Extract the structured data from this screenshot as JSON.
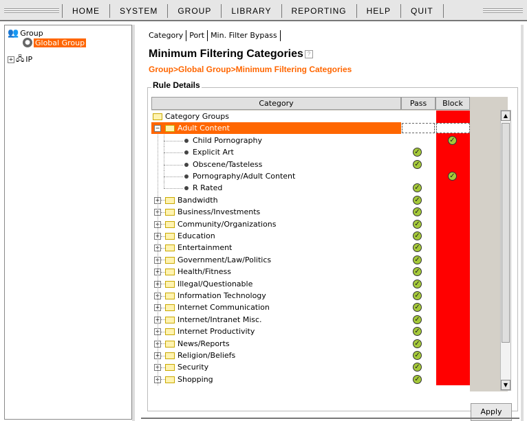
{
  "menu": [
    "HOME",
    "SYSTEM",
    "GROUP",
    "LIBRARY",
    "REPORTING",
    "HELP",
    "QUIT"
  ],
  "tree": {
    "root": "Group",
    "selected": "Global Group",
    "ip": "IP"
  },
  "tabs": [
    "Category",
    "Port",
    "Min. Filter Bypass"
  ],
  "page_title": "Minimum Filtering Categories",
  "breadcrumb": "Group>Global Group>Minimum Filtering Categories",
  "rule_details": "Rule Details",
  "table": {
    "headers": [
      "Category",
      "Pass",
      "Block"
    ],
    "rows": [
      {
        "label": "Category Groups",
        "kind": "root"
      },
      {
        "label": "Adult Content",
        "kind": "open-group",
        "selected": true
      },
      {
        "label": "Child Pornography",
        "kind": "child",
        "pass": false,
        "block": true
      },
      {
        "label": "Explicit Art",
        "kind": "child",
        "pass": true,
        "block": false
      },
      {
        "label": "Obscene/Tasteless",
        "kind": "child",
        "pass": true,
        "block": false
      },
      {
        "label": "Pornography/Adult Content",
        "kind": "child",
        "pass": false,
        "block": true
      },
      {
        "label": "R Rated",
        "kind": "child-last",
        "pass": true,
        "block": false
      },
      {
        "label": "Bandwidth",
        "kind": "group",
        "pass": true
      },
      {
        "label": "Business/Investments",
        "kind": "group",
        "pass": true
      },
      {
        "label": "Community/Organizations",
        "kind": "group",
        "pass": true
      },
      {
        "label": "Education",
        "kind": "group",
        "pass": true
      },
      {
        "label": "Entertainment",
        "kind": "group",
        "pass": true
      },
      {
        "label": "Government/Law/Politics",
        "kind": "group",
        "pass": true
      },
      {
        "label": "Health/Fitness",
        "kind": "group",
        "pass": true
      },
      {
        "label": "Illegal/Questionable",
        "kind": "group",
        "pass": true
      },
      {
        "label": "Information Technology",
        "kind": "group",
        "pass": true
      },
      {
        "label": "Internet Communication",
        "kind": "group",
        "pass": true
      },
      {
        "label": "Internet/Intranet Misc.",
        "kind": "group",
        "pass": true
      },
      {
        "label": "Internet Productivity",
        "kind": "group",
        "pass": true
      },
      {
        "label": "News/Reports",
        "kind": "group",
        "pass": true
      },
      {
        "label": "Religion/Beliefs",
        "kind": "group",
        "pass": true
      },
      {
        "label": "Security",
        "kind": "group",
        "pass": true
      },
      {
        "label": "Shopping",
        "kind": "group",
        "pass": true
      }
    ]
  },
  "apply_label": "Apply",
  "colors": {
    "accent": "#ff6600",
    "block": "#ff0000",
    "check": "#a5c93a"
  }
}
